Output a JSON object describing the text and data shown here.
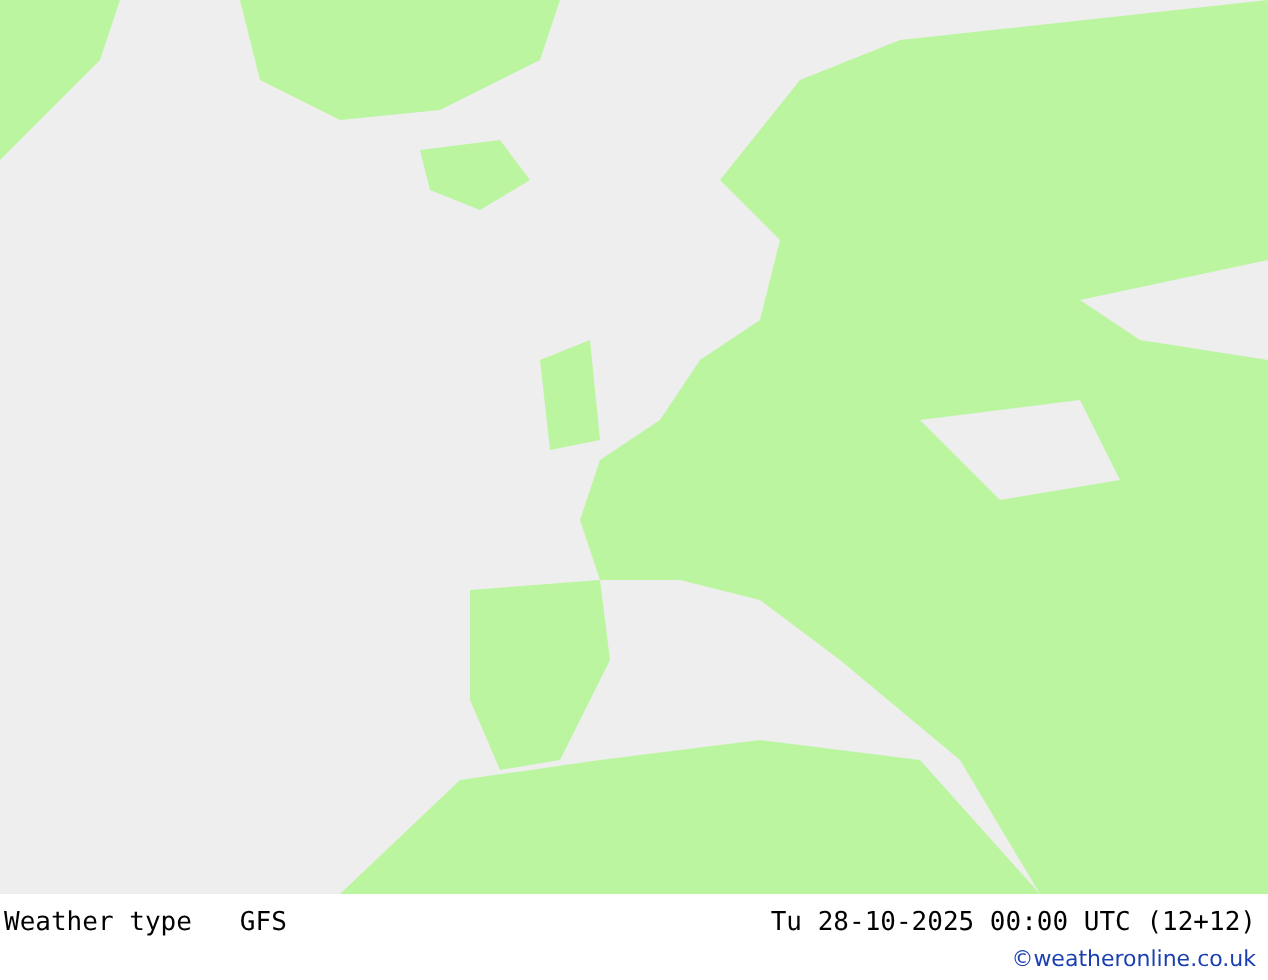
{
  "footer": {
    "title": "Weather type",
    "model": "GFS",
    "valid_time": "Tu 28-10-2025 00:00 UTC (12+12)",
    "credit": "©weatheronline.co.uk"
  }
}
